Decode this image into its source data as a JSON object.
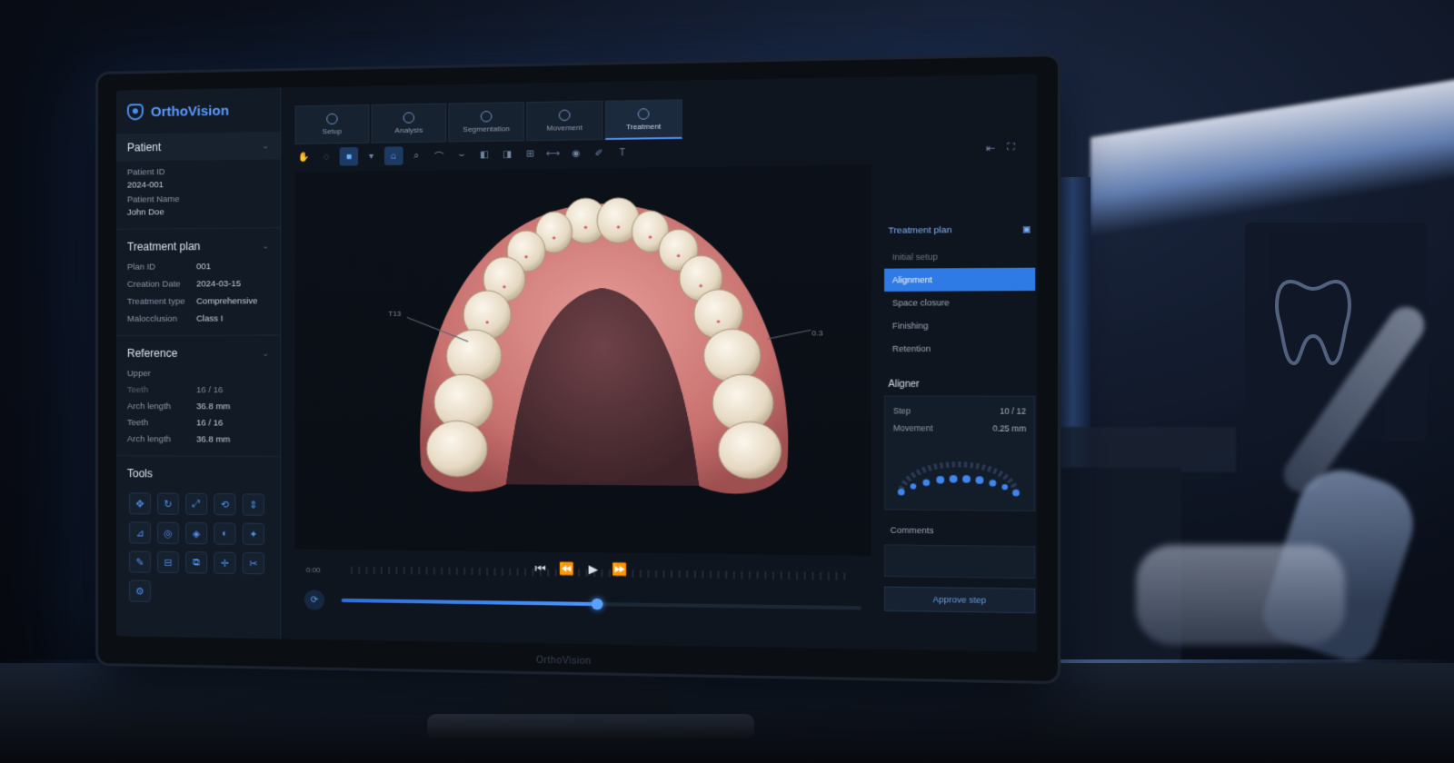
{
  "app": {
    "name": "OrthoVision",
    "monitor_brand": "OrthoVision"
  },
  "tabs": [
    {
      "label": "Setup",
      "active": false
    },
    {
      "label": "Analysis",
      "active": false
    },
    {
      "label": "Segmentation",
      "active": false
    },
    {
      "label": "Movement",
      "active": false
    },
    {
      "label": "Treatment",
      "active": true
    }
  ],
  "patient": {
    "heading": "Patient",
    "id_label": "Patient ID",
    "id_value": "2024-001",
    "name_label": "Patient Name",
    "name_value": "John Doe"
  },
  "treatment_plan": {
    "heading": "Treatment plan",
    "rows": [
      {
        "k": "Plan ID",
        "v": "001"
      },
      {
        "k": "Creation Date",
        "v": "2024-03-15"
      },
      {
        "k": "Treatment type",
        "v": "Comprehensive"
      },
      {
        "k": "Malocclusion",
        "v": "Class I"
      }
    ]
  },
  "reference": {
    "heading": "Reference",
    "rows": [
      {
        "k": "Upper",
        "v": ""
      },
      {
        "k": "Teeth",
        "v": "16 / 16"
      },
      {
        "k": "Arch length",
        "v": "36.8 mm"
      },
      {
        "k": "Teeth",
        "v": "16 / 16"
      },
      {
        "k": "Arch length",
        "v": "36.8 mm"
      }
    ]
  },
  "tools": {
    "heading": "Tools"
  },
  "viewport": {
    "annotation_left": "T13",
    "annotation_right": "0.3"
  },
  "playback": {
    "time": "0:00",
    "progress": 0.5
  },
  "right_panel": {
    "heading": "Treatment plan",
    "stages": [
      {
        "label": "Initial setup",
        "state": "muted"
      },
      {
        "label": "Alignment",
        "state": "active"
      },
      {
        "label": "Space closure",
        "state": "normal"
      },
      {
        "label": "Finishing",
        "state": "normal"
      },
      {
        "label": "Retention",
        "state": "normal"
      }
    ],
    "aligner": {
      "heading": "Aligner",
      "step_label": "Step",
      "step_value": "10 / 12",
      "movement_label": "Movement",
      "movement_value": "0.25 mm"
    },
    "comments_label": "Comments",
    "approve_label": "Approve step"
  },
  "colors": {
    "accent": "#2f7be6",
    "logo": "#5b9bff",
    "gum": "#d98986",
    "tooth": "#efe6d6"
  }
}
